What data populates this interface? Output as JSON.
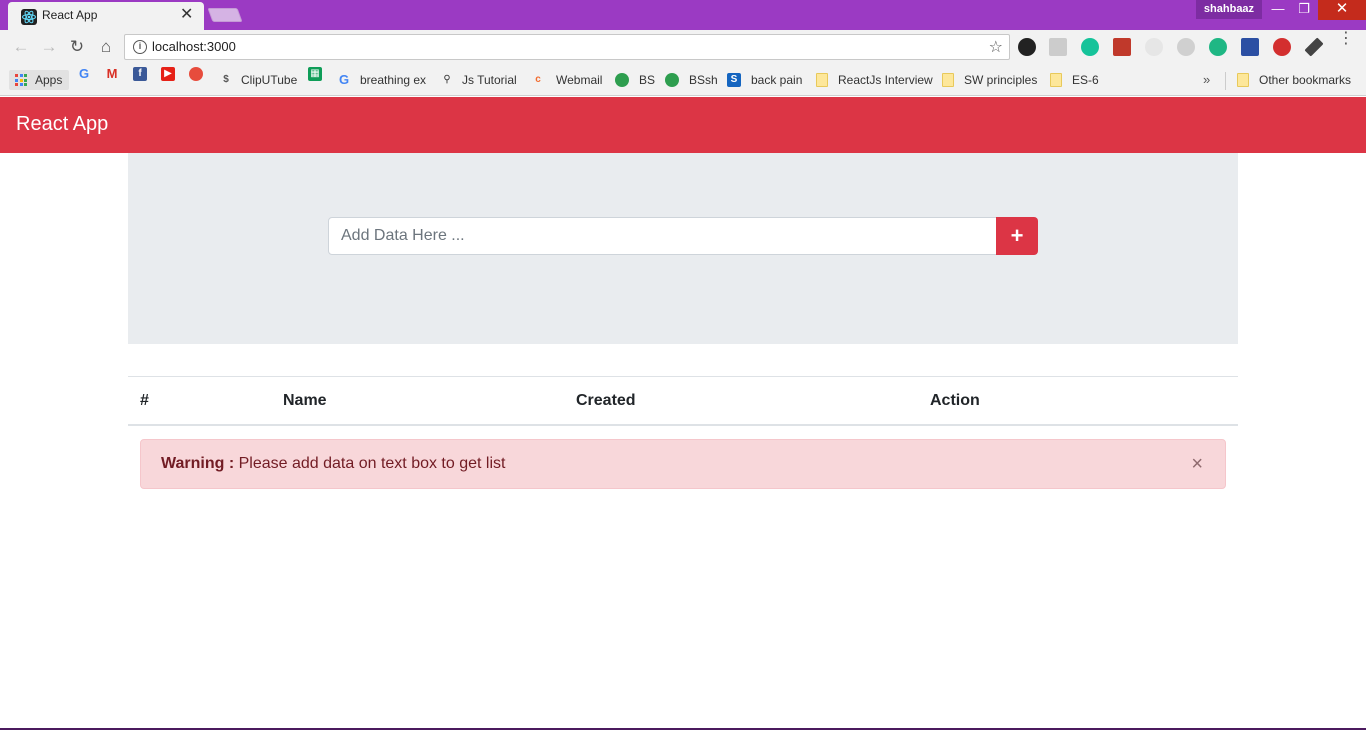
{
  "browser": {
    "tab_title": "React App",
    "profile_name": "shahbaaz",
    "url": "localhost:3000",
    "bookmarks": {
      "apps": "Apps",
      "items": [
        "ClipUTube",
        "breathing ex",
        "Js Tutorial",
        "Webmail",
        "BS",
        "BSsh",
        "back pain",
        "ReactJs Interview",
        "SW principles",
        "ES-6"
      ],
      "other": "Other bookmarks"
    }
  },
  "app": {
    "brand": "React App",
    "input_placeholder": "Add Data Here ...",
    "add_button_icon": "+",
    "table": {
      "headers": [
        "#",
        "Name",
        "Created",
        "Action"
      ]
    },
    "alert": {
      "label": "Warning :",
      "message": " Please add data on text box to get list",
      "close": "×"
    }
  },
  "colors": {
    "chrome_frame": "#9b3ac3",
    "navbar": "#dc3545",
    "jumbotron": "#e9ecef",
    "alert_bg": "#f8d7da",
    "alert_text": "#721c24"
  }
}
